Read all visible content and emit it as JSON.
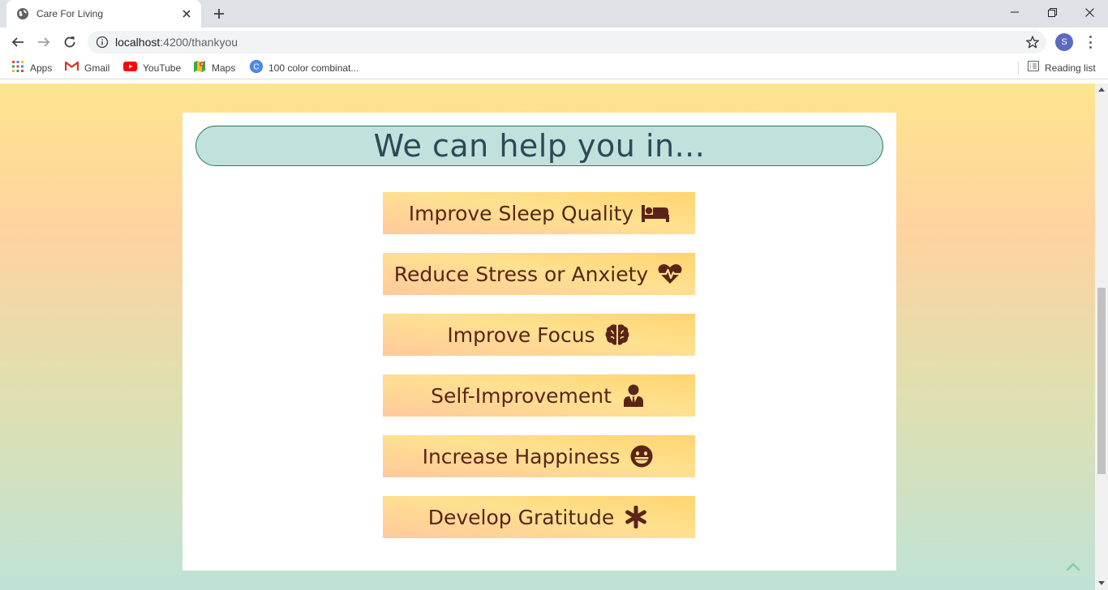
{
  "browser": {
    "tab_title": "Care For Living",
    "url_host": "localhost",
    "url_path": ":4200/thankyou",
    "profile_initial": "S",
    "bookmarks": [
      {
        "label": "Apps",
        "icon": "apps-grid-icon"
      },
      {
        "label": "Gmail",
        "icon": "gmail-icon"
      },
      {
        "label": "YouTube",
        "icon": "youtube-icon"
      },
      {
        "label": "Maps",
        "icon": "maps-icon"
      },
      {
        "label": "100 color combinat...",
        "icon": "canva-icon"
      }
    ],
    "reading_list": "Reading list"
  },
  "page": {
    "heading": "We can help you in...",
    "options": [
      {
        "label": "Improve Sleep Quality",
        "icon": "bed-icon"
      },
      {
        "label": "Reduce Stress or Anxiety",
        "icon": "heartbeat-icon"
      },
      {
        "label": "Improve Focus",
        "icon": "brain-icon"
      },
      {
        "label": "Self-Improvement",
        "icon": "user-tie-icon"
      },
      {
        "label": "Increase Happiness",
        "icon": "grin-icon"
      },
      {
        "label": "Develop Gratitude",
        "icon": "asterisk-icon"
      }
    ]
  },
  "colors": {
    "heading_pill": "#c0e1dc",
    "heading_text": "#2f4858",
    "option_text": "#5b2418",
    "gradient_top": "#fde68e",
    "gradient_bottom": "#bfe2d6"
  }
}
